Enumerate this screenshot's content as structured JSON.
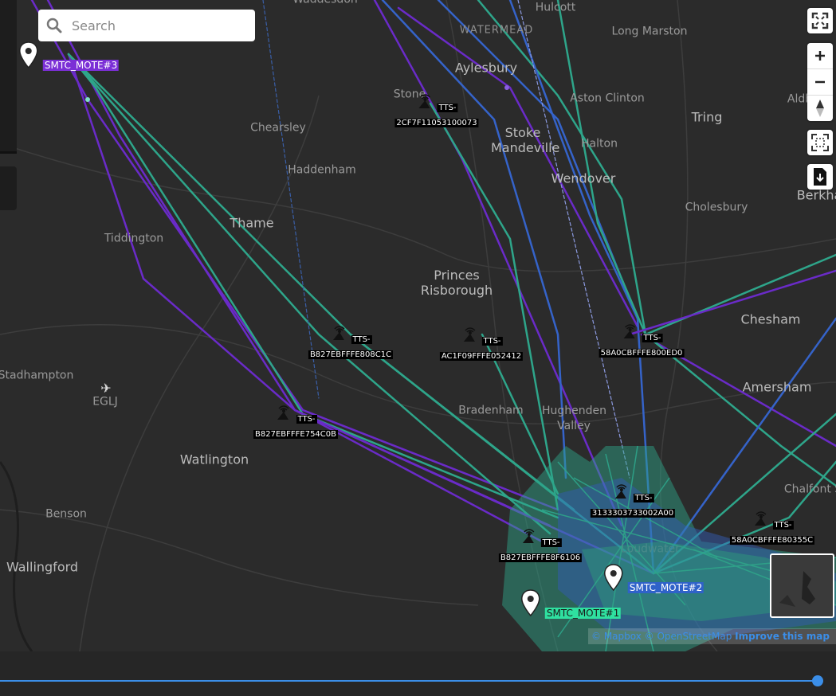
{
  "search": {
    "placeholder": "Search"
  },
  "places": [
    {
      "name": "Waddesdon",
      "kind": "place"
    },
    {
      "name": "Hulcott",
      "kind": "place"
    },
    {
      "name": "WATERMEAD",
      "kind": "small"
    },
    {
      "name": "Long Marston",
      "kind": "place"
    },
    {
      "name": "Aylesbury",
      "kind": "town"
    },
    {
      "name": "Stone",
      "kind": "place"
    },
    {
      "name": "Aston Clinton",
      "kind": "place"
    },
    {
      "name": "Aldbury",
      "kind": "place"
    },
    {
      "name": "Tring",
      "kind": "town"
    },
    {
      "name": "Chearsley",
      "kind": "place"
    },
    {
      "name": "Stoke Mandeville",
      "kind": "town"
    },
    {
      "name": "Halton",
      "kind": "place"
    },
    {
      "name": "Haddenham",
      "kind": "place"
    },
    {
      "name": "Wendover",
      "kind": "town"
    },
    {
      "name": "Berkha",
      "kind": "town"
    },
    {
      "name": "Cholesbury",
      "kind": "place"
    },
    {
      "name": "Thame",
      "kind": "town"
    },
    {
      "name": "Tiddington",
      "kind": "place"
    },
    {
      "name": "Princes Risborough",
      "kind": "town"
    },
    {
      "name": "Chesham",
      "kind": "town"
    },
    {
      "name": "Stadhampton",
      "kind": "place"
    },
    {
      "name": "EGLJ",
      "kind": "place"
    },
    {
      "name": "Amersham",
      "kind": "town"
    },
    {
      "name": "Bradenham",
      "kind": "place"
    },
    {
      "name": "Hughenden Valley",
      "kind": "place"
    },
    {
      "name": "Watlington",
      "kind": "town"
    },
    {
      "name": "Chalfont S",
      "kind": "place"
    },
    {
      "name": "Benson",
      "kind": "place"
    },
    {
      "name": "Loudwater",
      "kind": "place"
    },
    {
      "name": "Wallingford",
      "kind": "town"
    }
  ],
  "gateways": [
    {
      "id": "gw-2cf7",
      "line1": "TTS-",
      "line2": "2CF7F11053100073"
    },
    {
      "id": "gw-808c",
      "line1": "TTS-",
      "line2": "B827EBFFFE808C1C"
    },
    {
      "id": "gw-ac1f",
      "line1": "TTS-",
      "line2": "AC1F09FFFE052412"
    },
    {
      "id": "gw-800e",
      "line1": "TTS-",
      "line2": "58A0CBFFFE800ED0"
    },
    {
      "id": "gw-754c",
      "line1": "TTS-",
      "line2": "B827EBFFFE754C0B"
    },
    {
      "id": "gw-3133",
      "line1": "TTS-",
      "line2": "3133303733002A00"
    },
    {
      "id": "gw-8f61",
      "line1": "TTS-",
      "line2": "B827EBFFFE8F6106"
    },
    {
      "id": "gw-8035",
      "line1": "TTS-",
      "line2": "58A0CBFFFE80355C"
    }
  ],
  "motes": [
    {
      "label": "SMTC_MOTE#3",
      "bg": "#7b2fd6",
      "fg": "#ffffff"
    },
    {
      "label": "SMTC_MOTE#2",
      "bg": "#2f62c9",
      "fg": "#ffffff"
    },
    {
      "label": "SMTC_MOTE#1",
      "bg": "#2fe0a0",
      "fg": "#1a1a1a"
    }
  ],
  "colors": {
    "teal": "#2ea58a",
    "purple": "#6a2bc8",
    "blue": "#3563c9",
    "accent": "#3b8ee8"
  },
  "attribution": {
    "mapbox": "© Mapbox",
    "osm": "© OpenStreetMap",
    "improve": "Improve this map"
  },
  "controls": [
    "fullscreen-icon",
    "zoom-in-icon",
    "zoom-out-icon",
    "compass-icon",
    "fit-bounds-icon",
    "download-icon"
  ],
  "timeline": {
    "position": 1.0
  }
}
